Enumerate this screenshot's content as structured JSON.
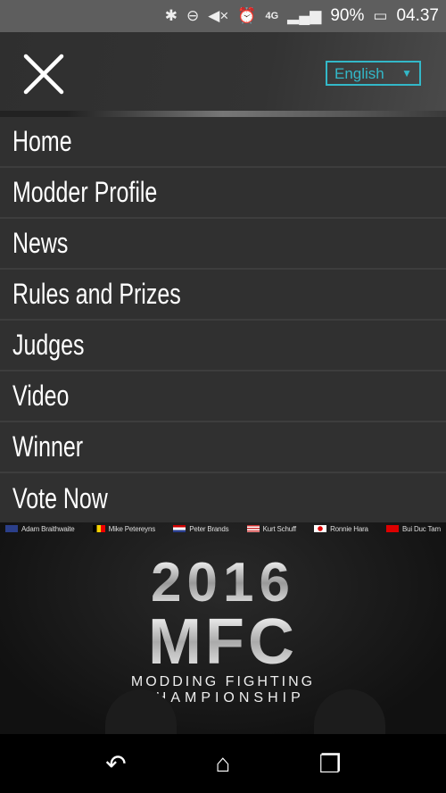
{
  "status_bar": {
    "battery": "90%",
    "time": "04.37",
    "network": "4G"
  },
  "header": {
    "language": "English"
  },
  "menu": {
    "items": [
      {
        "label": "Home"
      },
      {
        "label": "Modder Profile"
      },
      {
        "label": "News"
      },
      {
        "label": "Rules and Prizes"
      },
      {
        "label": "Judges"
      },
      {
        "label": "Video"
      },
      {
        "label": "Winner"
      },
      {
        "label": "Vote Now"
      }
    ]
  },
  "banner": {
    "fighters": [
      "Adam Braithwaite",
      "Mike Petereyns",
      "Peter Brands",
      "Kurt Schuff",
      "Ronnie Hara",
      "Bui Duc Tam"
    ],
    "year": "2016",
    "logo": "MFC",
    "subtitle_1": "MODDING FIGHTING",
    "subtitle_2": "CHAMPIONSHIP"
  },
  "colors": {
    "accent": "#33b8c8",
    "menu_bg": "#303030"
  }
}
